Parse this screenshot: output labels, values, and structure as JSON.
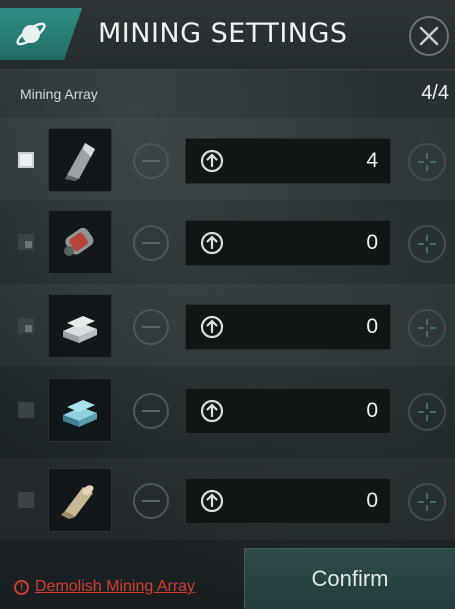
{
  "header": {
    "title": "MINING SETTINGS",
    "planet_icon": "planet-icon",
    "close_icon": "close-icon"
  },
  "array": {
    "label": "Mining Array",
    "count": "4/4"
  },
  "rows": [
    {
      "item_icon": "crystal-shard-icon",
      "value": "4",
      "checked": true
    },
    {
      "item_icon": "fuel-canister-icon",
      "value": "0",
      "checked": false
    },
    {
      "item_icon": "silver-ingot-icon",
      "value": "0",
      "checked": false
    },
    {
      "item_icon": "blue-ingot-icon",
      "value": "0",
      "checked": false
    },
    {
      "item_icon": "fabric-roll-icon",
      "value": "0",
      "checked": false
    }
  ],
  "footer": {
    "demolish_label": "Demolish Mining Array",
    "confirm_label": "Confirm"
  },
  "colors": {
    "accent_teal": "#2f8f84",
    "danger_red": "#d43a2f"
  }
}
